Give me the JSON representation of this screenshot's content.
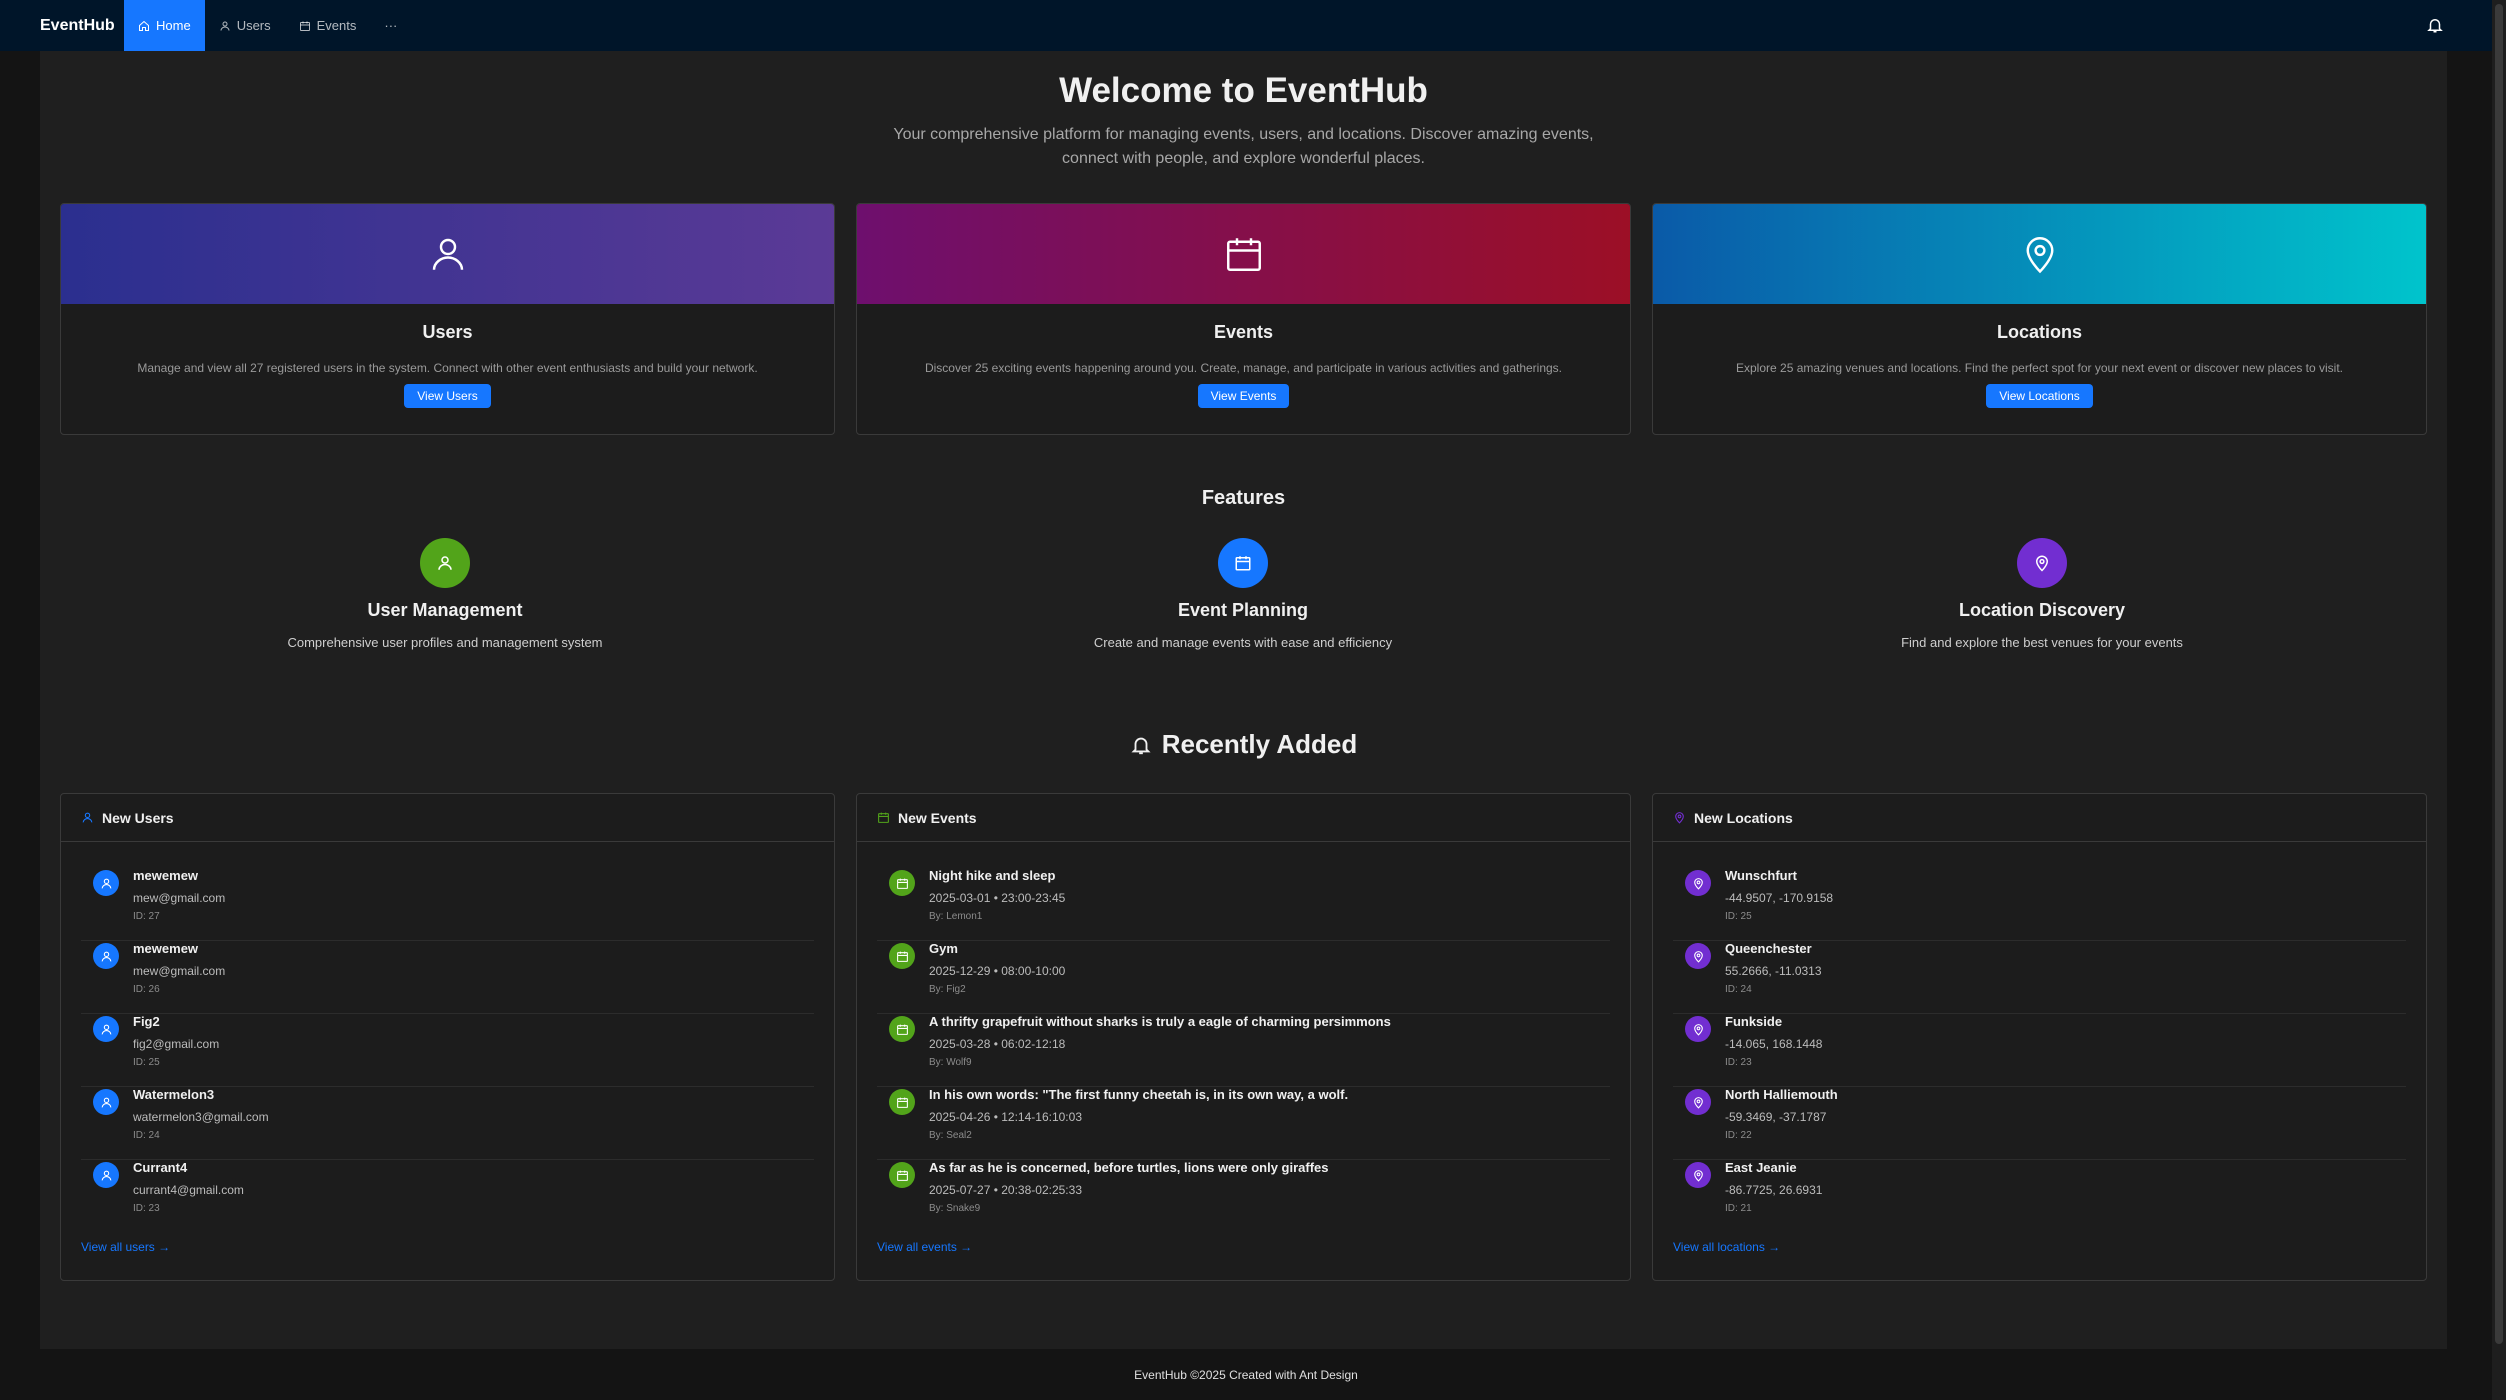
{
  "nav": {
    "brand": "EventHub",
    "items": [
      {
        "label": "Home",
        "icon": "home-icon",
        "active": true
      },
      {
        "label": "Users",
        "icon": "user-icon",
        "active": false
      },
      {
        "label": "Events",
        "icon": "calendar-icon",
        "active": false
      }
    ],
    "more_label": "···"
  },
  "hero": {
    "title": "Welcome to EventHub",
    "subtitle_line1": "Your comprehensive platform for managing events, users, and locations. Discover amazing events,",
    "subtitle_line2": "connect with people, and explore wonderful places."
  },
  "cards": [
    {
      "title": "Users",
      "description": "Manage and view all 27 registered users in the system. Connect with other event enthusiasts and build your network.",
      "button": "View Users",
      "icon": "user-icon",
      "gradient": [
        "#2b2f8f",
        "#5b3a96"
      ]
    },
    {
      "title": "Events",
      "description": "Discover 25 exciting events happening around you. Create, manage, and participate in various activities and gatherings.",
      "button": "View Events",
      "icon": "calendar-icon",
      "gradient": [
        "#6e0f6e",
        "#9c0f26"
      ]
    },
    {
      "title": "Locations",
      "description": "Explore 25 amazing venues and locations. Find the perfect spot for your next event or discover new places to visit.",
      "button": "View Locations",
      "icon": "location-pin-icon",
      "gradient": [
        "#0a5aa8",
        "#00c4cc"
      ]
    }
  ],
  "features": {
    "title": "Features",
    "items": [
      {
        "title": "User Management",
        "description": "Comprehensive user profiles and management system",
        "icon": "user-icon",
        "color": "#52a41a"
      },
      {
        "title": "Event Planning",
        "description": "Create and manage events with ease and efficiency",
        "icon": "calendar-icon",
        "color": "#1677ff"
      },
      {
        "title": "Location Discovery",
        "description": "Find and explore the best venues for your events",
        "icon": "location-pin-icon",
        "color": "#722ed1"
      }
    ]
  },
  "recent": {
    "title": "Recently Added",
    "users": {
      "header": "New Users",
      "view_all": "View all users →",
      "items": [
        {
          "name": "mewemew",
          "sub": "mew@gmail.com",
          "meta": "ID: 27"
        },
        {
          "name": "mewemew",
          "sub": "mew@gmail.com",
          "meta": "ID: 26"
        },
        {
          "name": "Fig2",
          "sub": "fig2@gmail.com",
          "meta": "ID: 25"
        },
        {
          "name": "Watermelon3",
          "sub": "watermelon3@gmail.com",
          "meta": "ID: 24"
        },
        {
          "name": "Currant4",
          "sub": "currant4@gmail.com",
          "meta": "ID: 23"
        }
      ]
    },
    "events": {
      "header": "New Events",
      "view_all": "View all events →",
      "items": [
        {
          "name": "Night hike and sleep",
          "sub": "2025-03-01 • 23:00-23:45",
          "meta": "By: Lemon1"
        },
        {
          "name": "Gym",
          "sub": "2025-12-29 • 08:00-10:00",
          "meta": "By: Fig2"
        },
        {
          "name": "A thrifty grapefruit without sharks is truly a eagle of charming persimmons",
          "sub": "2025-03-28 • 06:02-12:18",
          "meta": "By: Wolf9"
        },
        {
          "name": "In his own words: \"The first funny cheetah is, in its own way, a wolf.",
          "sub": "2025-04-26 • 12:14-16:10:03",
          "meta": "By: Seal2"
        },
        {
          "name": "As far as he is concerned, before turtles, lions were only giraffes",
          "sub": "2025-07-27 • 20:38-02:25:33",
          "meta": "By: Snake9"
        }
      ]
    },
    "locations": {
      "header": "New Locations",
      "view_all": "View all locations →",
      "items": [
        {
          "name": "Wunschfurt",
          "sub": "-44.9507, -170.9158",
          "meta": "ID: 25"
        },
        {
          "name": "Queenchester",
          "sub": "55.2666, -11.0313",
          "meta": "ID: 24"
        },
        {
          "name": "Funkside",
          "sub": "-14.065, 168.1448",
          "meta": "ID: 23"
        },
        {
          "name": "North Halliemouth",
          "sub": "-59.3469, -37.1787",
          "meta": "ID: 22"
        },
        {
          "name": "East Jeanie",
          "sub": "-86.7725, 26.6931",
          "meta": "ID: 21"
        }
      ]
    }
  },
  "footer": {
    "text": "EventHub ©2025 Created with Ant Design"
  },
  "colors": {
    "primary": "#1677ff",
    "user_avatar": "#1677ff",
    "event_avatar": "#52a41a",
    "location_avatar": "#722ed1"
  }
}
